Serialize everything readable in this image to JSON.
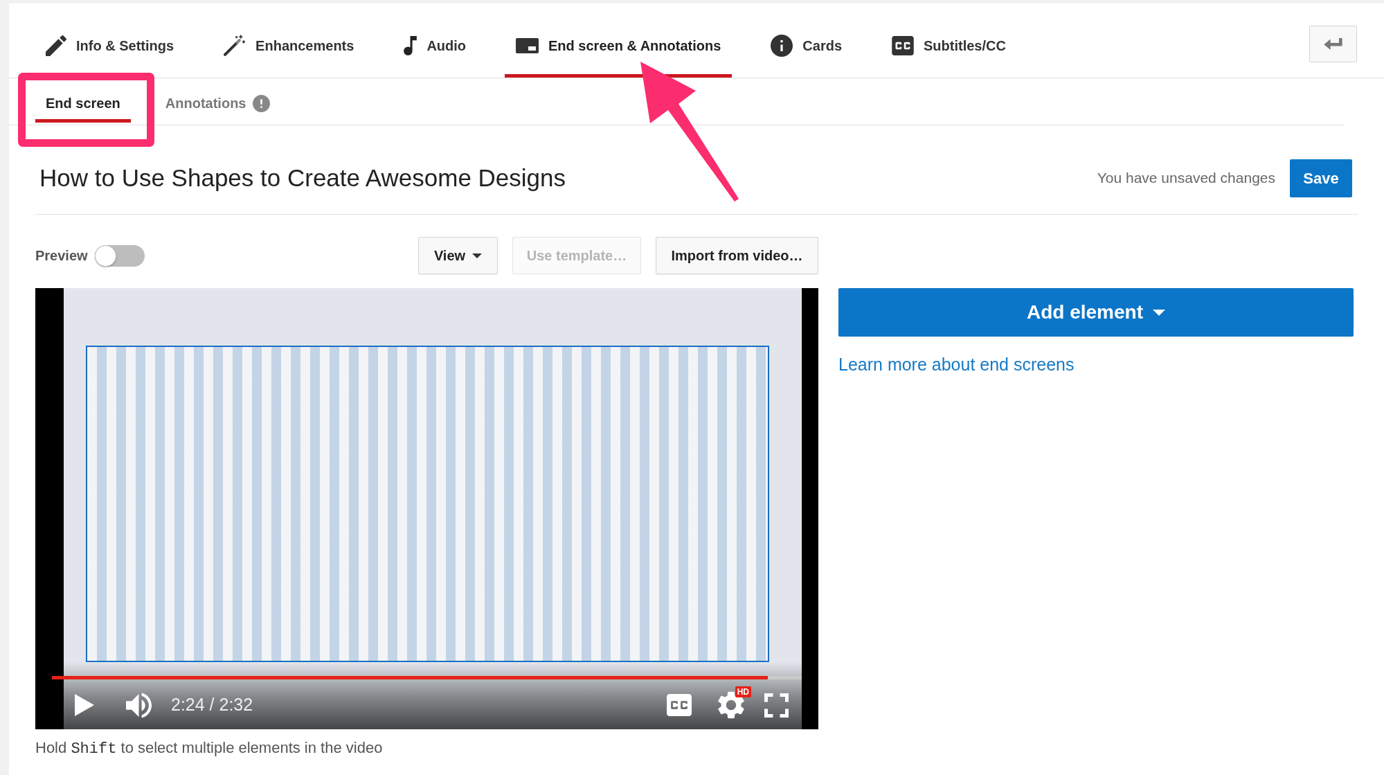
{
  "tabs": [
    {
      "label": "Info & Settings",
      "selected": false,
      "arrow_annotation": false
    },
    {
      "label": "Enhancements",
      "selected": false,
      "arrow_annotation": false
    },
    {
      "label": "Audio",
      "selected": false,
      "arrow_annotation": false
    },
    {
      "label": "End screen & Annotations",
      "selected": true,
      "arrow_annotation": true
    },
    {
      "label": "Cards",
      "selected": false,
      "arrow_annotation": false
    },
    {
      "label": "Subtitles/CC",
      "selected": false,
      "arrow_annotation": false
    }
  ],
  "subtabs": [
    {
      "label": "End screen",
      "selected": true,
      "alert": false,
      "frame_annotation": true
    },
    {
      "label": "Annotations",
      "selected": false,
      "alert": true,
      "frame_annotation": false
    }
  ],
  "header": {
    "title": "How to Use Shapes to Create Awesome Designs",
    "status": "You have unsaved changes",
    "save_button": "Save"
  },
  "toolbar": {
    "preview": {
      "label": "Preview",
      "on": false
    },
    "buttons": [
      {
        "label": "View",
        "kind": "dropdown",
        "disabled": false
      },
      {
        "label": "Use template…",
        "kind": "plain",
        "disabled": true
      },
      {
        "label": "Import from video…",
        "kind": "plain",
        "disabled": false
      }
    ]
  },
  "player": {
    "playing": false,
    "progress": {
      "level": 0.955
    },
    "time": "2:24 / 2:32",
    "quality_badge": "HD"
  },
  "sidebar": {
    "add_element_button": "Add element",
    "learn_more_link": "Learn more about end screens"
  },
  "hint": {
    "before": "Hold",
    "key": "Shift",
    "after": "to select multiple elements in the video"
  }
}
